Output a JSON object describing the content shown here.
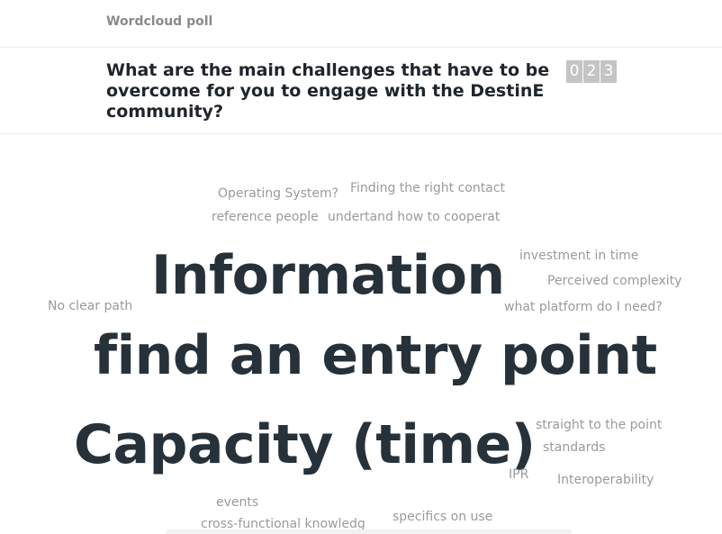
{
  "header": {
    "poll_type": "Wordcloud poll"
  },
  "question": {
    "text": "What are the main challenges that have to be overcome for you to engage with the DestinE community?",
    "response_count_digits": [
      "0",
      "2",
      "3"
    ]
  },
  "wordcloud": {
    "words": [
      {
        "text": "Operating System?",
        "weight": "small"
      },
      {
        "text": "Finding the right contact",
        "weight": "small"
      },
      {
        "text": "reference people",
        "weight": "small"
      },
      {
        "text": "undertand how to cooperat",
        "weight": "small"
      },
      {
        "text": "investment in time",
        "weight": "small"
      },
      {
        "text": "Information",
        "weight": "large"
      },
      {
        "text": "Perceived complexity",
        "weight": "small"
      },
      {
        "text": "No clear path",
        "weight": "small"
      },
      {
        "text": "what platform do I need?",
        "weight": "small"
      },
      {
        "text": "find an entry point",
        "weight": "large"
      },
      {
        "text": "straight to the point",
        "weight": "small"
      },
      {
        "text": "standards",
        "weight": "small"
      },
      {
        "text": "Capacity (time)",
        "weight": "large"
      },
      {
        "text": "IPR",
        "weight": "small"
      },
      {
        "text": "Interoperability",
        "weight": "small"
      },
      {
        "text": "events",
        "weight": "small"
      },
      {
        "text": "cross-functional knowledg",
        "weight": "small"
      },
      {
        "text": "specifics on use",
        "weight": "small"
      }
    ]
  }
}
